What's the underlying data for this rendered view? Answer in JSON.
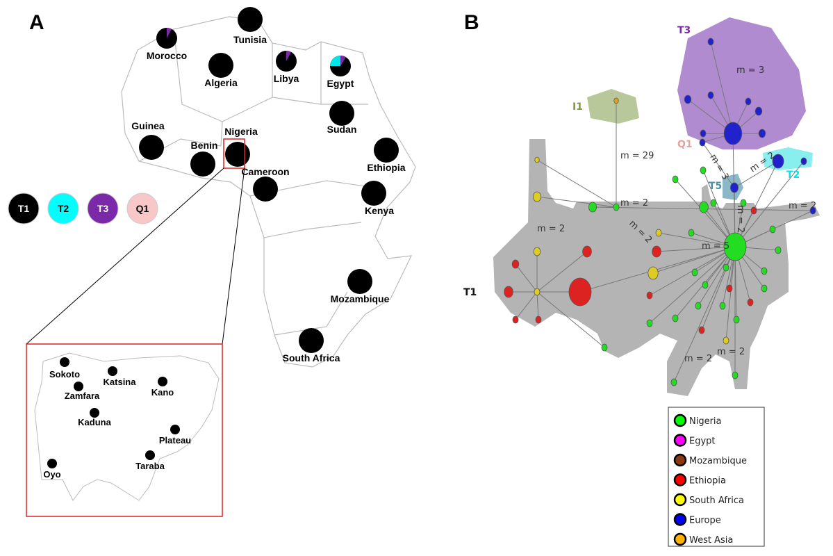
{
  "panels": {
    "a": "A",
    "b": "B"
  },
  "map": {
    "countries": [
      "Tunisia",
      "Morocco",
      "Algeria",
      "Libya",
      "Egypt",
      "Sudan",
      "Guinea",
      "Nigeria",
      "Benin",
      "Ethiopia",
      "Cameroon",
      "Kenya",
      "Mozambique",
      "South Africa"
    ],
    "haplogroup_key": [
      {
        "label": "T1",
        "color": "#000000",
        "text_color": "#ffffff"
      },
      {
        "label": "T2",
        "color": "#00ffff",
        "text_color": "#000000"
      },
      {
        "label": "T3",
        "color": "#7a2aa8",
        "text_color": "#ffffff"
      },
      {
        "label": "Q1",
        "color": "#f8c8c8",
        "text_color": "#000000"
      }
    ],
    "nigeria_inset": {
      "states": [
        "Sokoto",
        "Katsina",
        "Zamfara",
        "Kano",
        "Kaduna",
        "Plateau",
        "Taraba",
        "Oyo"
      ]
    }
  },
  "network": {
    "clusters": [
      {
        "label": "T3",
        "color": "#7a2aa8"
      },
      {
        "label": "I1",
        "color": "#7f9a3a"
      },
      {
        "label": "Q1",
        "color": "#e8a0a0"
      },
      {
        "label": "T5",
        "color": "#4a90a8"
      },
      {
        "label": "T2",
        "color": "#00e5e5"
      },
      {
        "label": "T1",
        "color": "#111111"
      }
    ],
    "mutation_labels": [
      "m = 3",
      "m = 29",
      "m = 3",
      "m = 2",
      "m = 2",
      "m = 2",
      "m = 2",
      "m = 5",
      "m = 2",
      "m = 2",
      "m = 2",
      "m = 2"
    ],
    "legend": [
      {
        "label": "Nigeria",
        "color": "#00ff00"
      },
      {
        "label": "Egypt",
        "color": "#ff00ff"
      },
      {
        "label": "Mozambique",
        "color": "#8b3a0f"
      },
      {
        "label": "Ethiopia",
        "color": "#ff0000"
      },
      {
        "label": "South Africa",
        "color": "#ffff00"
      },
      {
        "label": "Europe",
        "color": "#0000ff"
      },
      {
        "label": "West Asia",
        "color": "#ffb000"
      }
    ]
  }
}
